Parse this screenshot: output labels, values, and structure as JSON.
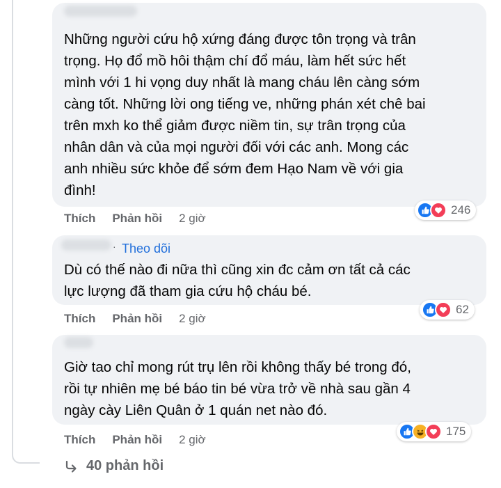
{
  "comments": [
    {
      "text": "Những người cứu hộ xứng đáng được tôn trọng và trân\ntrọng. Họ đổ mồ hôi thậm chí đổ máu, làm hết sức hết\nmình với 1 hi vọng duy nhất là mang cháu lên càng sớm\ncàng tốt. Những lời ong tiếng ve, những phán xét chê bai\ntrên mxh ko thể giảm được niềm tin, sự trân trọng của\nnhân dân và của mọi người đối với các anh. Mong các\nanh nhiều sức khỏe để sớm đem Hạo Nam về với gia\nđình!",
      "like_label": "Thích",
      "reply_label": "Phản hồi",
      "time": "2 giờ",
      "reaction_icons": [
        "like-icon",
        "love-icon"
      ],
      "reaction_count": "246"
    },
    {
      "follow_label": "Theo dõi",
      "text": "Dù có thế nào đi nữa thì cũng xin đc cảm ơn tất cả các\nlực lượng đã tham gia cứu hộ cháu bé.",
      "like_label": "Thích",
      "reply_label": "Phản hồi",
      "time": "2 giờ",
      "reaction_icons": [
        "like-icon",
        "love-icon"
      ],
      "reaction_count": "62"
    },
    {
      "text": "Giờ tao chỉ mong rút trụ lên rồi không thấy bé trong đó,\nrồi tự nhiên mẹ bé báo tin bé vừa trở về nhà sau gần 4\nngày cày Liên Quân ở 1 quán net nào đó.",
      "like_label": "Thích",
      "reply_label": "Phản hồi",
      "time": "2 giờ",
      "reaction_icons": [
        "like-icon",
        "haha-icon",
        "love-icon"
      ],
      "reaction_count": "175"
    }
  ],
  "more_replies": {
    "icon": "reply-arrow-icon",
    "label": "40 phản hồi"
  },
  "colors": {
    "bubble": "#f0f2f5",
    "meta_text": "#65676b",
    "follow": "#216fdb",
    "like": "#1877f2",
    "love": "#f33e58",
    "haha": "#f7b125"
  }
}
